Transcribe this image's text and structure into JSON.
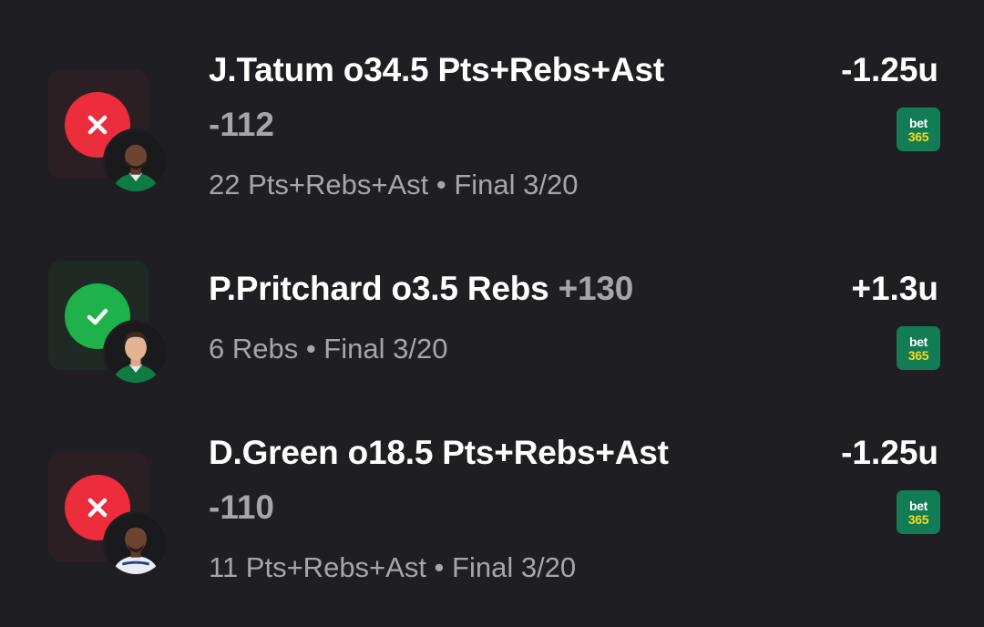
{
  "bets": [
    {
      "status": "lost",
      "status_icon": "x-icon",
      "player_name": "J.Tatum",
      "avatar_team_color": "#0f7a43",
      "title": "J.Tatum o34.5 Pts+Rebs+Ast",
      "odds": "-112",
      "result": "22 Pts+Rebs+Ast • Final 3/20",
      "units": "-1.25u",
      "sportsbook": {
        "line1": "bet",
        "line2": "365"
      }
    },
    {
      "status": "won",
      "status_icon": "check-icon",
      "player_name": "P.Pritchard",
      "avatar_team_color": "#0f7a43",
      "title": "P.Pritchard o3.5 Rebs",
      "odds": "+130",
      "result": "6 Rebs • Final 3/20",
      "units": "+1.3u",
      "sportsbook": {
        "line1": "bet",
        "line2": "365"
      }
    },
    {
      "status": "lost",
      "status_icon": "x-icon",
      "player_name": "D.Green",
      "avatar_team_color": "#e9ecf2",
      "title": "D.Green o18.5 Pts+Rebs+Ast",
      "odds": "-110",
      "result": "11 Pts+Rebs+Ast • Final 3/20",
      "units": "-1.25u",
      "sportsbook": {
        "line1": "bet",
        "line2": "365"
      }
    }
  ],
  "colors": {
    "background": "#1f1f23",
    "loss": "#eb2d3c",
    "win": "#1fb24a",
    "secondary_text": "#a5a5ab",
    "bet365_green": "#127c55",
    "bet365_yellow": "#f5dc1e"
  }
}
